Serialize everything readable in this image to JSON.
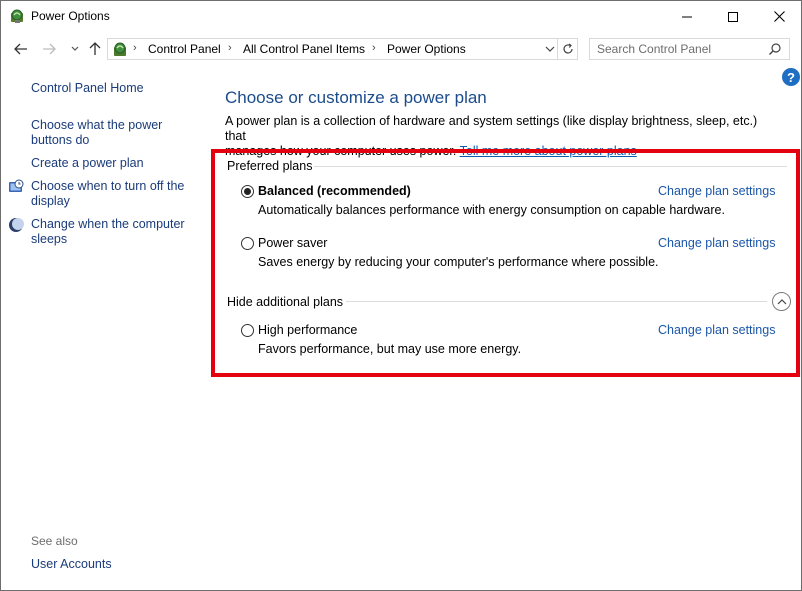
{
  "window": {
    "title": "Power Options",
    "controls": {
      "minimize": "minimize",
      "maximize": "maximize",
      "close": "close"
    }
  },
  "address": {
    "crumbs": [
      "Control Panel",
      "All Control Panel Items",
      "Power Options"
    ],
    "search_placeholder": "Search Control Panel"
  },
  "sidebar": {
    "home": "Control Panel Home",
    "items": [
      {
        "label_line1": "Choose what the power",
        "label_line2": "buttons do",
        "icon": "none"
      },
      {
        "label_line1": "Create a power plan",
        "label_line2": "",
        "icon": "none"
      },
      {
        "label_line1": "Choose when to turn off the",
        "label_line2": "display",
        "icon": "display-clock-icon"
      },
      {
        "label_line1": "Change when the computer",
        "label_line2": "sleeps",
        "icon": "moon-icon"
      }
    ],
    "see_also": "See also",
    "user_accounts": "User Accounts"
  },
  "main": {
    "heading": "Choose or customize a power plan",
    "desc_line1": "A power plan is a collection of hardware and system settings (like display brightness, sleep, etc.) that",
    "desc_line2": "manages how your computer uses power.",
    "tell_more": "Tell me more about power plans",
    "preferred_label": "Preferred plans",
    "hide_label": "Hide additional plans",
    "plans": [
      {
        "name": "Balanced (recommended)",
        "desc": "Automatically balances performance with energy consumption on capable hardware.",
        "selected": true,
        "change": "Change plan settings"
      },
      {
        "name": "Power saver",
        "desc": "Saves energy by reducing your computer's performance where possible.",
        "selected": false,
        "change": "Change plan settings"
      },
      {
        "name": "High performance",
        "desc": "Favors performance, but may use more energy.",
        "selected": false,
        "change": "Change plan settings"
      }
    ]
  },
  "colors": {
    "highlight": "#e3000f",
    "link": "#1a56a8",
    "heading": "#1c4b8c",
    "help": "#1e6fc4"
  }
}
